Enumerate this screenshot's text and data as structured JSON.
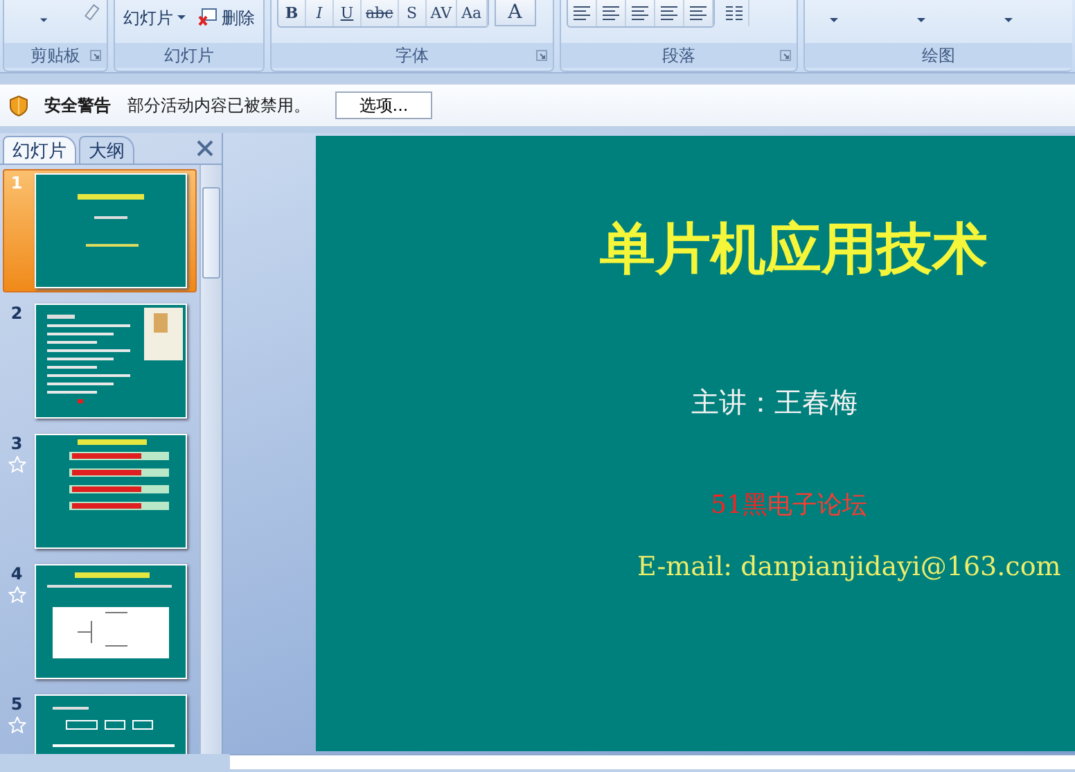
{
  "ribbon": {
    "groups": [
      {
        "label": "剪贴板",
        "launcher": true,
        "kind": "clipboard"
      },
      {
        "label": "幻灯片",
        "launcher": false,
        "kind": "slides",
        "new_slide": "幻灯片",
        "delete": "删除"
      },
      {
        "label": "字体",
        "launcher": true,
        "kind": "font",
        "keys": [
          "B",
          "I",
          "U",
          "abc",
          "S",
          "AV",
          "Aa",
          "A"
        ]
      },
      {
        "label": "段落",
        "launcher": true,
        "kind": "paragraph"
      },
      {
        "label": "绘图",
        "launcher": false,
        "kind": "drawing"
      }
    ]
  },
  "security_bar": {
    "title": "安全警告",
    "message": "部分活动内容已被禁用。",
    "button": "选项..."
  },
  "pane": {
    "tabs": [
      {
        "label": "幻灯片",
        "selected": true
      },
      {
        "label": "大纲",
        "selected": false
      }
    ],
    "slides": [
      {
        "number": "1",
        "selected": true,
        "animated": false,
        "kind": "title"
      },
      {
        "number": "2",
        "selected": false,
        "animated": false,
        "kind": "list"
      },
      {
        "number": "3",
        "selected": false,
        "animated": true,
        "kind": "bars"
      },
      {
        "number": "4",
        "selected": false,
        "animated": true,
        "kind": "diagram"
      },
      {
        "number": "5",
        "selected": false,
        "animated": true,
        "kind": "blocks"
      }
    ]
  },
  "slide": {
    "title": "单片机应用技术",
    "speaker": "主讲：王春梅",
    "forum": [
      {
        "text": "51黑",
        "color": "#ff1f1f"
      },
      {
        "text": "电子论坛",
        "color": "#ff3a30"
      }
    ],
    "email": "E-mail: danpianjidayi@163.com"
  }
}
